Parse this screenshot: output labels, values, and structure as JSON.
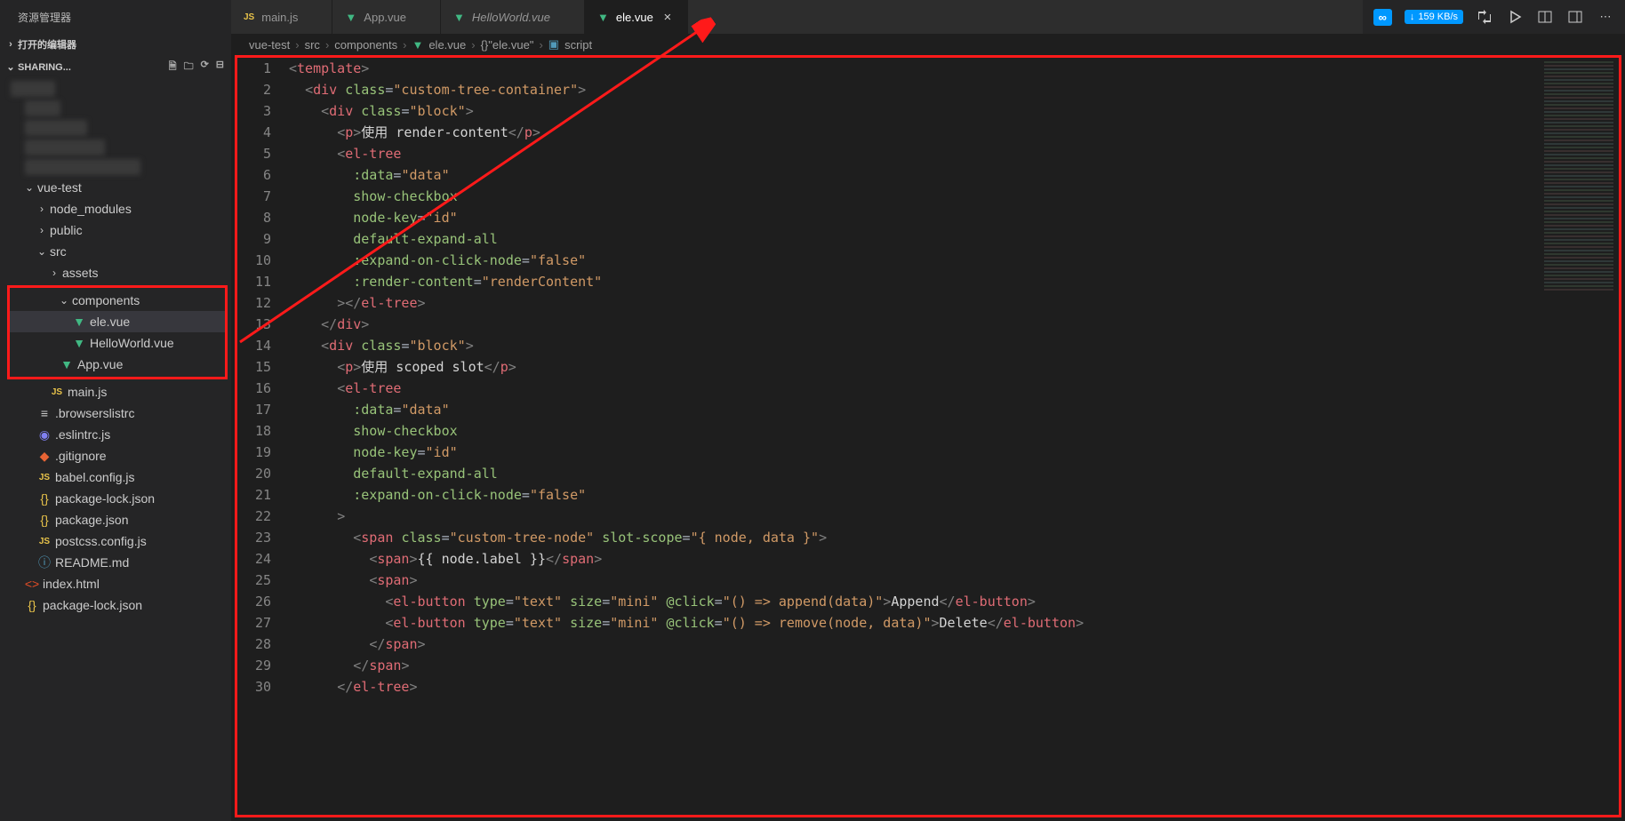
{
  "sidebar_title": "资源管理器",
  "opened_editors_title": "打开的编辑器",
  "workspace_title": "SHARING...",
  "tabs": [
    {
      "label": "main.js",
      "icon": "js",
      "active": false,
      "italic": false
    },
    {
      "label": "App.vue",
      "icon": "vue",
      "active": false,
      "italic": false
    },
    {
      "label": "HelloWorld.vue",
      "icon": "vue",
      "active": false,
      "italic": true
    },
    {
      "label": "ele.vue",
      "icon": "vue",
      "active": true,
      "italic": false
    }
  ],
  "speed_badge": "159 KB/s",
  "breadcrumb": [
    "vue-test",
    "src",
    "components",
    "ele.vue",
    "{}\"ele.vue\"",
    "script"
  ],
  "tree": {
    "vue_test": "vue-test",
    "node_modules": "node_modules",
    "public": "public",
    "src": "src",
    "assets": "assets",
    "components": "components",
    "ele_vue": "ele.vue",
    "helloworld_vue": "HelloWorld.vue",
    "app_vue": "App.vue",
    "main_js": "main.js",
    "browserslistrc": ".browserslistrc",
    "eslintrc": ".eslintrc.js",
    "gitignore": ".gitignore",
    "babel": "babel.config.js",
    "pkglock": "package-lock.json",
    "pkg": "package.json",
    "postcss": "postcss.config.js",
    "readme": "README.md",
    "indexhtml": "index.html",
    "pkglock2": "package-lock.json"
  },
  "code_lines": [
    {
      "n": 1,
      "html": "<span class='t-brkt'>&lt;</span><span class='t-tag'>template</span><span class='t-brkt'>&gt;</span>"
    },
    {
      "n": 2,
      "html": "  <span class='t-brkt'>&lt;</span><span class='t-tag'>div</span> <span class='t-attr'>class</span><span class='t-punct'>=</span><span class='t-str'>\"custom-tree-container\"</span><span class='t-brkt'>&gt;</span>"
    },
    {
      "n": 3,
      "html": "    <span class='t-brkt'>&lt;</span><span class='t-tag'>div</span> <span class='t-attr'>class</span><span class='t-punct'>=</span><span class='t-str'>\"block\"</span><span class='t-brkt'>&gt;</span>"
    },
    {
      "n": 4,
      "html": "      <span class='t-brkt'>&lt;</span><span class='t-tag'>p</span><span class='t-brkt'>&gt;</span><span class='t-text'>使用 render-content</span><span class='t-brkt'>&lt;/</span><span class='t-tag'>p</span><span class='t-brkt'>&gt;</span>"
    },
    {
      "n": 5,
      "html": "      <span class='t-brkt'>&lt;</span><span class='t-tag'>el-tree</span>"
    },
    {
      "n": 6,
      "html": "        <span class='t-attr'>:data</span><span class='t-punct'>=</span><span class='t-str'>\"data\"</span>"
    },
    {
      "n": 7,
      "html": "        <span class='t-attr'>show-checkbox</span>"
    },
    {
      "n": 8,
      "html": "        <span class='t-attr'>node-key</span><span class='t-punct'>=</span><span class='t-str'>\"id\"</span>"
    },
    {
      "n": 9,
      "html": "        <span class='t-attr'>default-expand-all</span>"
    },
    {
      "n": 10,
      "html": "        <span class='t-attr'>:expand-on-click-node</span><span class='t-punct'>=</span><span class='t-str'>\"</span><span class='t-bool'>false</span><span class='t-str'>\"</span>"
    },
    {
      "n": 11,
      "html": "        <span class='t-attr'>:render-content</span><span class='t-punct'>=</span><span class='t-str'>\"renderContent\"</span>"
    },
    {
      "n": 12,
      "html": "      <span class='t-brkt'>&gt;&lt;/</span><span class='t-tag'>el-tree</span><span class='t-brkt'>&gt;</span>"
    },
    {
      "n": 13,
      "html": "    <span class='t-brkt'>&lt;/</span><span class='t-tag'>div</span><span class='t-brkt'>&gt;</span>"
    },
    {
      "n": 14,
      "html": "    <span class='t-brkt'>&lt;</span><span class='t-tag'>div</span> <span class='t-attr'>class</span><span class='t-punct'>=</span><span class='t-str'>\"block\"</span><span class='t-brkt'>&gt;</span>"
    },
    {
      "n": 15,
      "html": "      <span class='t-brkt'>&lt;</span><span class='t-tag'>p</span><span class='t-brkt'>&gt;</span><span class='t-text'>使用 scoped slot</span><span class='t-brkt'>&lt;/</span><span class='t-tag'>p</span><span class='t-brkt'>&gt;</span>"
    },
    {
      "n": 16,
      "html": "      <span class='t-brkt'>&lt;</span><span class='t-tag'>el-tree</span>"
    },
    {
      "n": 17,
      "html": "        <span class='t-attr'>:data</span><span class='t-punct'>=</span><span class='t-str'>\"data\"</span>"
    },
    {
      "n": 18,
      "html": "        <span class='t-attr'>show-checkbox</span>"
    },
    {
      "n": 19,
      "html": "        <span class='t-attr'>node-key</span><span class='t-punct'>=</span><span class='t-str'>\"id\"</span>"
    },
    {
      "n": 20,
      "html": "        <span class='t-attr'>default-expand-all</span>"
    },
    {
      "n": 21,
      "html": "        <span class='t-attr'>:expand-on-click-node</span><span class='t-punct'>=</span><span class='t-str'>\"</span><span class='t-bool'>false</span><span class='t-str'>\"</span>"
    },
    {
      "n": 22,
      "html": "      <span class='t-brkt'>&gt;</span>"
    },
    {
      "n": 23,
      "html": "        <span class='t-brkt'>&lt;</span><span class='t-tag'>span</span> <span class='t-attr'>class</span><span class='t-punct'>=</span><span class='t-str'>\"custom-tree-node\"</span> <span class='t-attr'>slot-scope</span><span class='t-punct'>=</span><span class='t-str'>\"{ node, data }\"</span><span class='t-brkt'>&gt;</span>"
    },
    {
      "n": 24,
      "html": "          <span class='t-brkt'>&lt;</span><span class='t-tag'>span</span><span class='t-brkt'>&gt;</span><span class='t-text'>{{ node.label }}</span><span class='t-brkt'>&lt;/</span><span class='t-tag'>span</span><span class='t-brkt'>&gt;</span>"
    },
    {
      "n": 25,
      "html": "          <span class='t-brkt'>&lt;</span><span class='t-tag'>span</span><span class='t-brkt'>&gt;</span>"
    },
    {
      "n": 26,
      "html": "            <span class='t-brkt'>&lt;</span><span class='t-tag'>el-button</span> <span class='t-attr'>type</span><span class='t-punct'>=</span><span class='t-str'>\"text\"</span> <span class='t-attr'>size</span><span class='t-punct'>=</span><span class='t-str'>\"mini\"</span> <span class='t-attr'>@click</span><span class='t-punct'>=</span><span class='t-str'>\"() =&gt; append(data)\"</span><span class='t-brkt'>&gt;</span><span class='t-text'>Append</span><span class='t-brkt'>&lt;/</span><span class='t-tag'>el-button</span><span class='t-brkt'>&gt;</span>"
    },
    {
      "n": 27,
      "html": "            <span class='t-brkt'>&lt;</span><span class='t-tag'>el-button</span> <span class='t-attr'>type</span><span class='t-punct'>=</span><span class='t-str'>\"text\"</span> <span class='t-attr'>size</span><span class='t-punct'>=</span><span class='t-str'>\"mini\"</span> <span class='t-attr'>@click</span><span class='t-punct'>=</span><span class='t-str'>\"() =&gt; remove(node, data)\"</span><span class='t-brkt'>&gt;</span><span class='t-text'>Delete</span><span class='t-brkt'>&lt;/</span><span class='t-tag'>el-button</span><span class='t-brkt'>&gt;</span>"
    },
    {
      "n": 28,
      "html": "          <span class='t-brkt'>&lt;/</span><span class='t-tag'>span</span><span class='t-brkt'>&gt;</span>"
    },
    {
      "n": 29,
      "html": "        <span class='t-brkt'>&lt;/</span><span class='t-tag'>span</span><span class='t-brkt'>&gt;</span>"
    },
    {
      "n": 30,
      "html": "      <span class='t-brkt'>&lt;/</span><span class='t-tag'>el-tree</span><span class='t-brkt'>&gt;</span>"
    }
  ]
}
